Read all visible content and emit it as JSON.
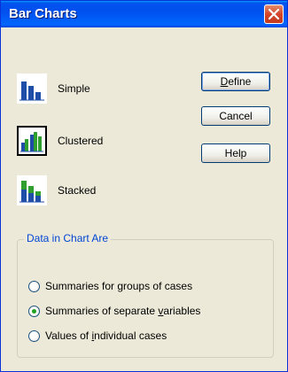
{
  "window": {
    "title": "Bar Charts"
  },
  "chart_types": [
    {
      "label": "Simple",
      "icon": "simple-bar-chart-icon",
      "selected": false
    },
    {
      "label": "Clustered",
      "icon": "clustered-bar-chart-icon",
      "selected": true
    },
    {
      "label": "Stacked",
      "icon": "stacked-bar-chart-icon",
      "selected": false
    }
  ],
  "buttons": {
    "define": {
      "before": "",
      "mnemonic": "D",
      "after": "efine"
    },
    "cancel": "Cancel",
    "help": "Help"
  },
  "data_group": {
    "legend": "Data in Chart Are",
    "options": [
      {
        "before": "Summaries for ",
        "mnemonic": "g",
        "after": "roups of cases",
        "selected": false
      },
      {
        "before": "Summaries of separate ",
        "mnemonic": "v",
        "after": "ariables",
        "selected": true
      },
      {
        "before": "Values of ",
        "mnemonic": "i",
        "after": "ndividual cases",
        "selected": false
      }
    ]
  },
  "colors": {
    "titlebar": "#0054e3",
    "chart_blue": "#1f4ea8",
    "chart_green": "#2fa02f",
    "radio_dot": "#21a121",
    "groupbox_title": "#0046d5"
  }
}
